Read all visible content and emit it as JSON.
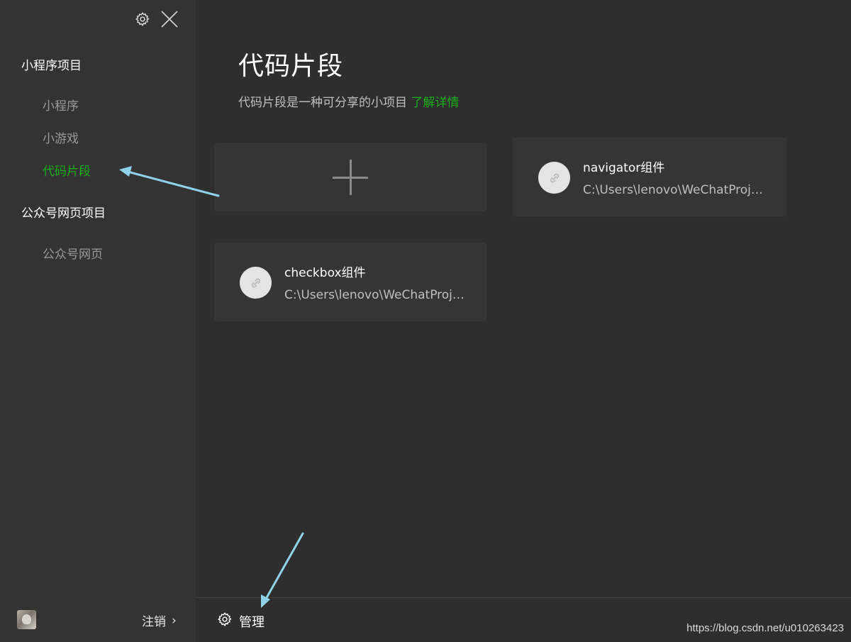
{
  "sidebar": {
    "settings_icon": "gear-icon",
    "close_icon": "close-icon",
    "sections": [
      {
        "title": "小程序项目",
        "items": [
          {
            "label": "小程序"
          },
          {
            "label": "小游戏"
          },
          {
            "label": "代码片段",
            "active": true
          }
        ]
      },
      {
        "title": "公众号网页项目",
        "items": [
          {
            "label": "公众号网页"
          }
        ]
      }
    ],
    "footer": {
      "logout_label": "注销",
      "logout_chevron": "›"
    }
  },
  "main": {
    "title": "代码片段",
    "subtitle": "代码片段是一种可分享的小项目",
    "subtitle_link": "了解详情",
    "projects": [
      {
        "name": "navigator组件",
        "path": "C:\\Users\\lenovo\\WeChatProjects\\navigator"
      },
      {
        "name": "checkbox组件",
        "path": "C:\\Users\\lenovo\\WeChatProjects\\checkbox"
      }
    ],
    "bottom": {
      "manage_label": "管理"
    }
  },
  "watermark": "https://blog.csdn.net/u010263423",
  "colors": {
    "accent": "#1aad19",
    "sidebar_bg": "#333333",
    "main_bg": "#2e2e2e",
    "card_bg": "#353535",
    "annotation_arrow": "#8fd3ea"
  }
}
